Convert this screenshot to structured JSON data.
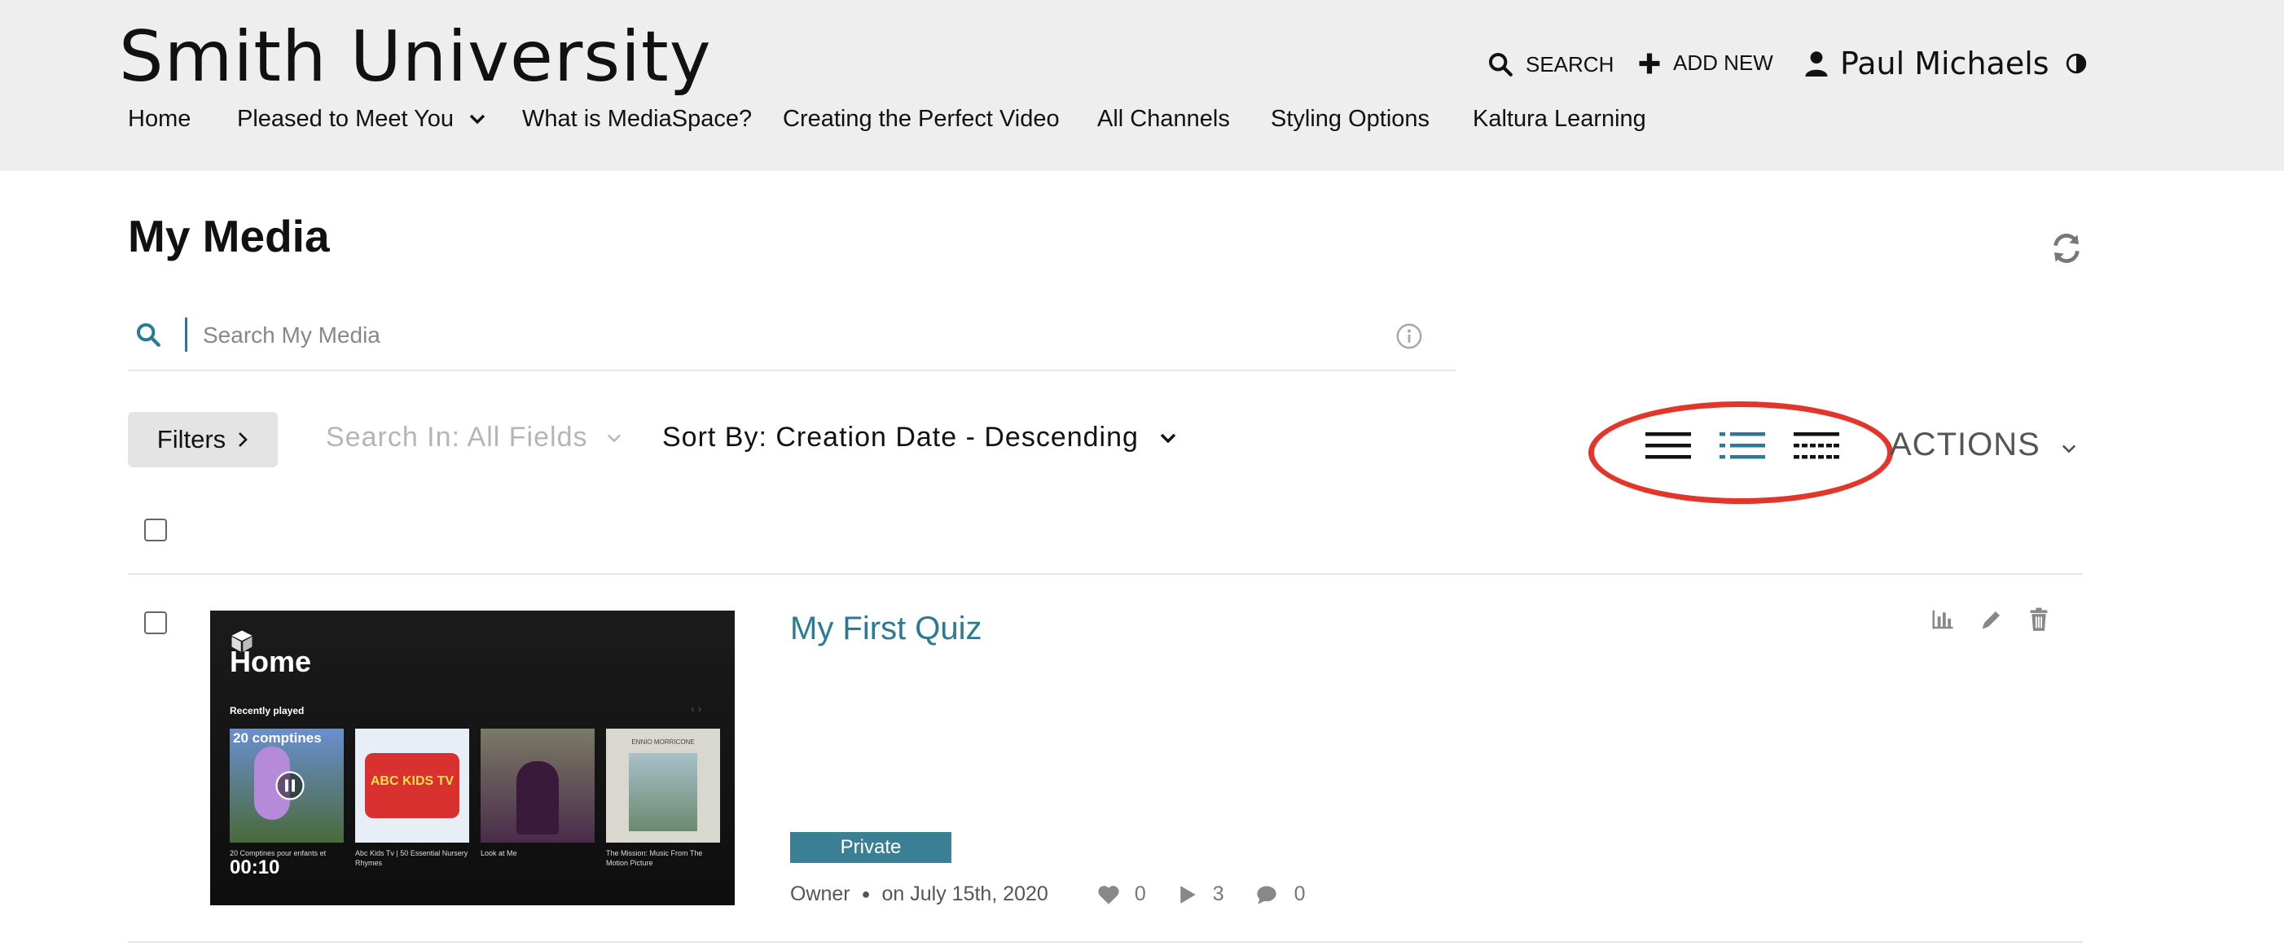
{
  "header": {
    "site_title": "Smith University",
    "search_label": "SEARCH",
    "add_new_label": "ADD NEW",
    "user_name": "Paul Michaels"
  },
  "nav": {
    "items": [
      {
        "label": "Home"
      },
      {
        "label": "Pleased to Meet You"
      },
      {
        "label": "What is MediaSpace?"
      },
      {
        "label": "Creating the Perfect Video"
      },
      {
        "label": "All Channels"
      },
      {
        "label": "Styling Options"
      },
      {
        "label": "Kaltura Learning"
      }
    ]
  },
  "page": {
    "title": "My Media"
  },
  "search": {
    "placeholder": "Search My Media"
  },
  "toolbar": {
    "filters_label": "Filters",
    "search_in_label": "Search In: All Fields",
    "sort_by_label": "Sort By: Creation Date - Descending",
    "actions_label": "ACTIONS",
    "view_modes": [
      "details",
      "list",
      "grid"
    ],
    "active_view": "list"
  },
  "media_items": [
    {
      "title": "My First Quiz",
      "status_badge": "Private",
      "owner_label": "Owner",
      "date_label": "on July 15th, 2020",
      "likes": "0",
      "plays": "3",
      "comments": "0",
      "thumbnail": {
        "heading": "Home",
        "section": "Recently played",
        "duration": "00:10",
        "cards": [
          {
            "art_text": "20 comptines",
            "caption": "20 Comptines pour enfants et"
          },
          {
            "art_text": "ABC KIDS TV",
            "caption": "Abc Kids Tv | 50 Essential Nursery Rhymes"
          },
          {
            "art_text": "",
            "caption": "Look at Me"
          },
          {
            "art_text": "ENNIO MORRICONE",
            "caption": "The Mission: Music From The Motion Picture"
          }
        ]
      }
    }
  ],
  "colors": {
    "accent": "#2a7a95",
    "highlight_ring": "#e2362a",
    "header_bg": "#eeeeee",
    "badge_bg": "#3a7f93"
  }
}
